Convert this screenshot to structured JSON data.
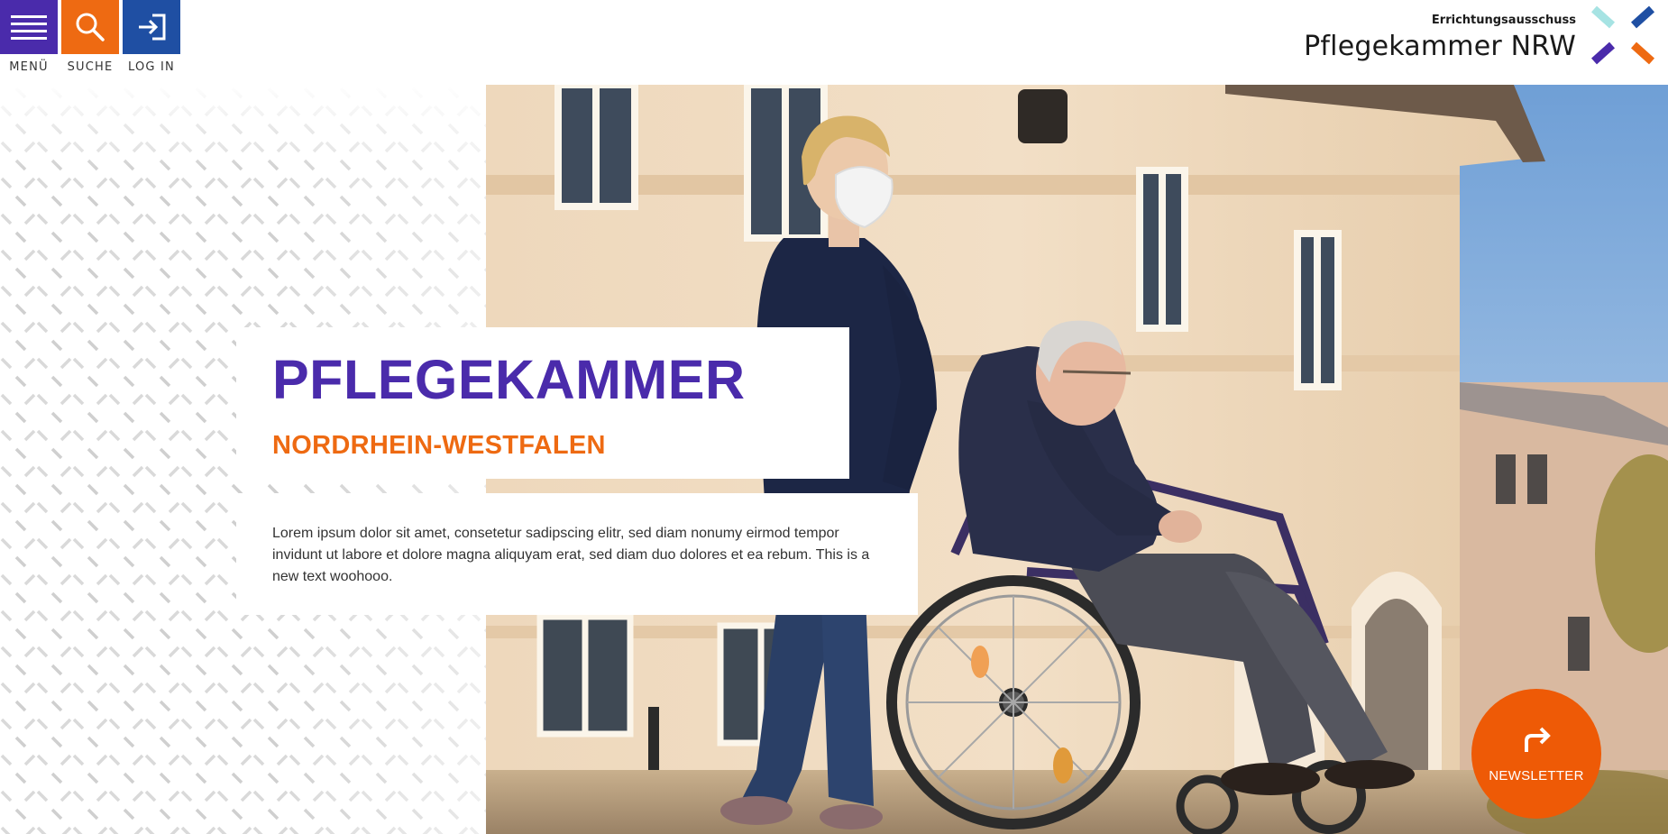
{
  "nav": {
    "menu_label": "MENÜ",
    "search_label": "SUCHE",
    "login_label": "LOG IN"
  },
  "logo": {
    "subtitle": "Errichtungsausschuss",
    "title": "Pflegekammer NRW"
  },
  "hero": {
    "title": "PFLEGEKAMMER",
    "subtitle": "NORDRHEIN-WESTFALEN",
    "text": "Lorem ipsum dolor sit amet, consetetur sadipscing elitr, sed diam nonumy eirmod tempor invidunt ut labore et dolore magna aliquyam erat, sed diam duo dolores et ea rebum. This is a new text woohooo.",
    "image_alt": "Pflegekraft mit Maske schiebt einen älteren Mann im Rollstuhl vor einem Gebäude"
  },
  "newsletter": {
    "label": "NEWSLETTER"
  },
  "colors": {
    "purple": "#4a2bab",
    "orange": "#ee6a12",
    "blue": "#1f4fa3",
    "teal": "#a6e3e3"
  },
  "icons": {
    "menu": "hamburger-icon",
    "search": "search-icon",
    "login": "login-icon",
    "newsletter": "share-arrow-icon"
  }
}
